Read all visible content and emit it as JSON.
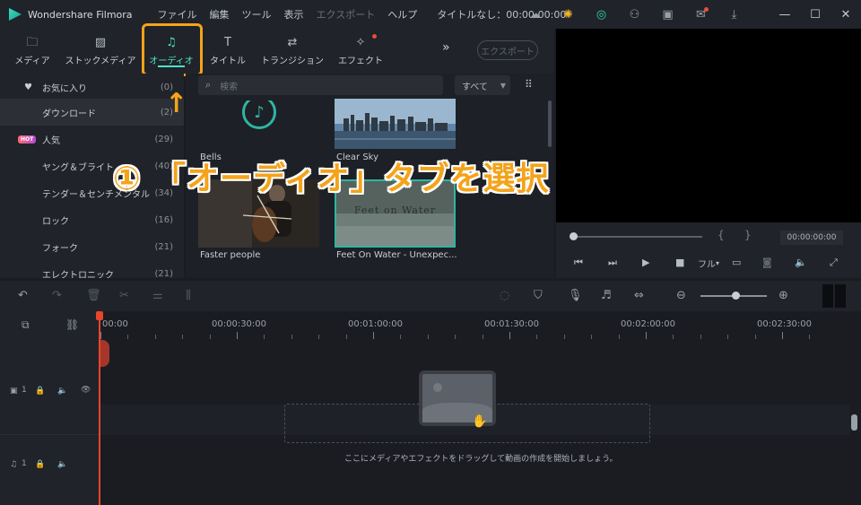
{
  "app": {
    "name": "Wondershare Filmora",
    "menu": [
      "ファイル",
      "編集",
      "ツール",
      "表示",
      "エクスポート",
      "ヘルプ"
    ],
    "doc_title": "タイトルなし：00:00:00:00",
    "title_icons": [
      "cloud-icon",
      "bulb-icon",
      "headset-icon",
      "user-icon",
      "save-icon",
      "mail-icon",
      "download-icon"
    ]
  },
  "tabs": [
    {
      "label": "メディア",
      "icon": "folder-icon"
    },
    {
      "label": "ストックメディア",
      "icon": "image-icon"
    },
    {
      "label": "オーディオ",
      "icon": "music-icon"
    },
    {
      "label": "タイトル",
      "icon": "text-icon"
    },
    {
      "label": "トランジション",
      "icon": "transition-icon"
    },
    {
      "label": "エフェクト",
      "icon": "effect-icon"
    }
  ],
  "export_label": "エクスポート",
  "library": [
    {
      "name": "お気に入り",
      "count": "(0)"
    },
    {
      "name": "ダウンロード",
      "count": "(2)"
    },
    {
      "name": "人気",
      "count": "(29)",
      "badge": "HOT"
    },
    {
      "name": "ヤング＆ブライト",
      "count": "(40)"
    },
    {
      "name": "テンダー＆センチメンタル",
      "count": "(34)"
    },
    {
      "name": "ロック",
      "count": "(16)"
    },
    {
      "name": "フォーク",
      "count": "(21)"
    },
    {
      "name": "エレクトロニック",
      "count": "(21)"
    }
  ],
  "search": {
    "placeholder": "検索"
  },
  "filter": {
    "value": "すべて"
  },
  "media_items": [
    {
      "caption": "Bells"
    },
    {
      "caption": "Clear Sky"
    },
    {
      "caption": "Faster people"
    },
    {
      "caption": "Feet On Water - Unexpec...",
      "overlay": "Feet on Water"
    }
  ],
  "preview": {
    "timecode": "00:00:00:00",
    "quality": "フル"
  },
  "annotation": {
    "arrow": "↑",
    "callout": "① 「オーディオ」タブを選択"
  },
  "timeline": {
    "ruler": [
      "00:00",
      "00:00:30:00",
      "00:01:00:00",
      "00:01:30:00",
      "00:02:00:00",
      "00:02:30:00"
    ],
    "video_track": "1",
    "audio_track": "1",
    "drop_hint": "ここにメディアやエフェクトをドラッグして動画の作成を開始しましょう。"
  },
  "colors": {
    "accent": "#4fe3c7",
    "annotation": "#f4a31a",
    "playhead": "#e8452c"
  }
}
